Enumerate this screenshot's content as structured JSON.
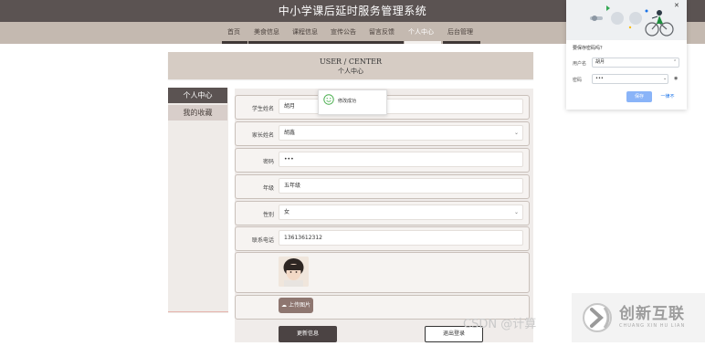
{
  "site_title": "中小学课后延时服务管理系统",
  "nav": [
    "首页",
    "美食信息",
    "课程信息",
    "宣传公告",
    "留言反馈",
    "个人中心",
    "后台管理"
  ],
  "active_nav": "个人中心",
  "banner": {
    "title_en": "USER / CENTER",
    "title_cn": "个人中心"
  },
  "sidebar": {
    "items": [
      "个人中心",
      "我的收藏"
    ]
  },
  "form": {
    "fields": [
      {
        "label": "学生姓名",
        "value": "胡月"
      },
      {
        "label": "家长姓名",
        "value": "胡鑫"
      },
      {
        "label": "密码",
        "value": "•••"
      },
      {
        "label": "年级",
        "value": "五年级"
      },
      {
        "label": "性别",
        "value": "女"
      },
      {
        "label": "联系电话",
        "value": "13613612312"
      }
    ]
  },
  "upload_label": "上传图片",
  "buttons": {
    "update": "更新信息",
    "logout": "退出登录"
  },
  "toast": {
    "text": "修改成功"
  },
  "password_popup": {
    "title": "要保存密码吗？",
    "username_label": "用户名",
    "username_value": "胡月",
    "password_label": "密码",
    "password_value": "•••",
    "save": "保存",
    "never": "一律不",
    "close": "✕"
  },
  "watermark": {
    "csdn": "CSDN @计算",
    "brand_cn": "创新互联",
    "brand_en": "CHUANG XIN HU LIAN"
  },
  "colors": {
    "header": "#5b5352",
    "nav_bg": "#c4b9b0",
    "banner_bg": "#d6ccc4",
    "accent_dark": "#4b4343",
    "toast_green": "#4caf50",
    "popup_blue": "#8ab4f8"
  }
}
